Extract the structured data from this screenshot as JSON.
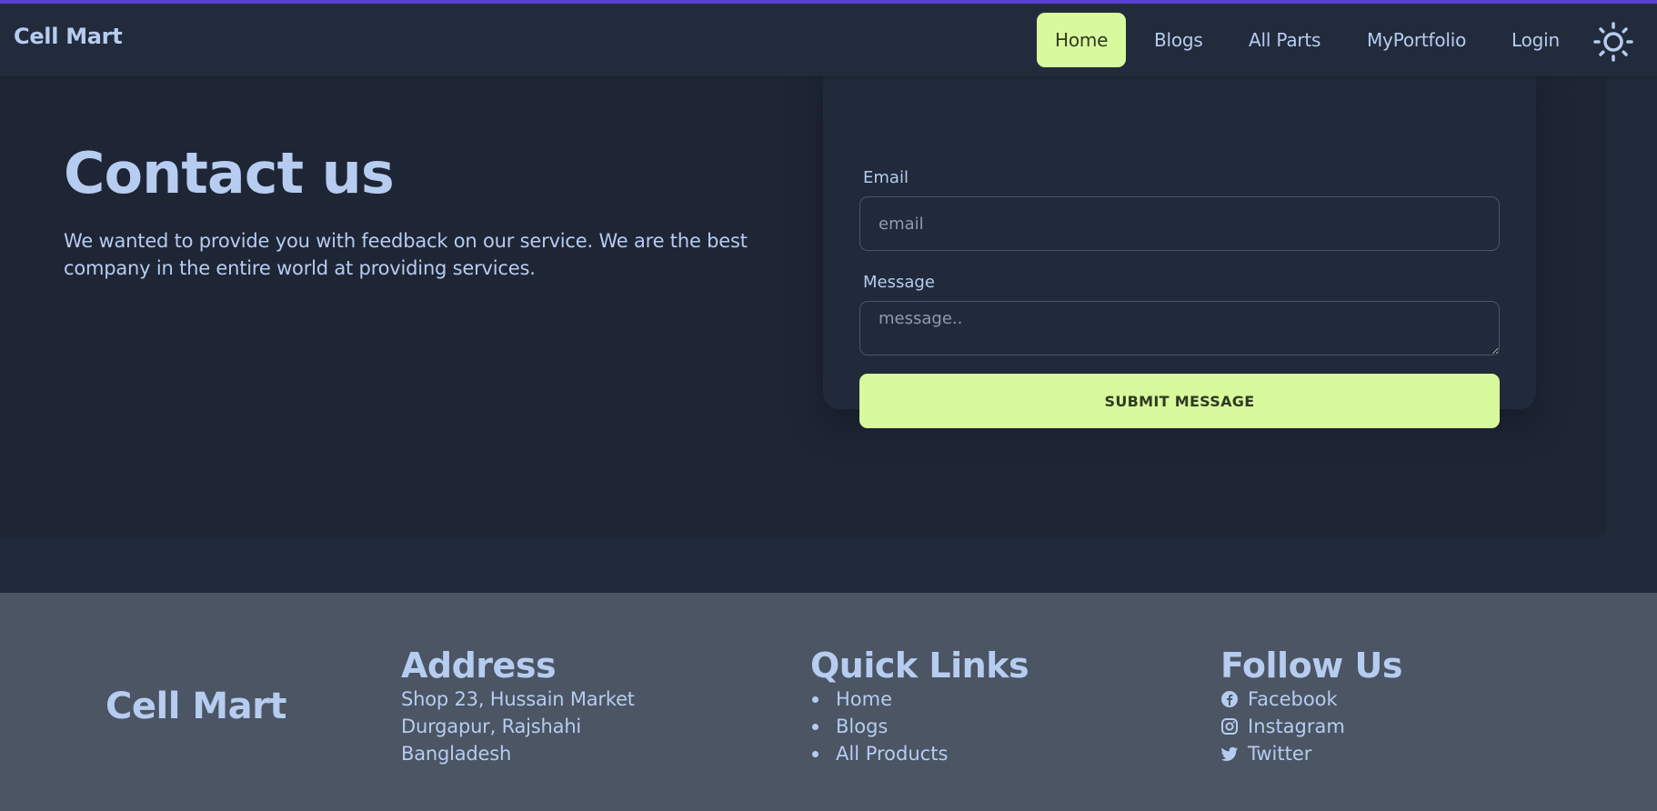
{
  "colors": {
    "accent": "#d9f99d",
    "navbar_bg": "#222b3b",
    "hero_bg": "#1e2535",
    "footer_bg": "#4b5563",
    "text": "#b6ccf0",
    "top_line": "#5b3fd6"
  },
  "navbar": {
    "brand": "Cell Mart",
    "items": [
      {
        "label": "Home",
        "active": true
      },
      {
        "label": "Blogs"
      },
      {
        "label": "All Parts"
      },
      {
        "label": "MyPortfolio"
      },
      {
        "label": "Login"
      }
    ],
    "theme_icon": "sun-icon"
  },
  "hero": {
    "title": "Contact us",
    "text": "We wanted to provide you with feedback on our service. We are the best company in the entire world at providing services."
  },
  "form": {
    "email_label": "Email",
    "email_placeholder": "email",
    "message_label": "Message",
    "message_placeholder": "message..",
    "submit_label": "SUBMIT MESSAGE"
  },
  "footer": {
    "brand": "Cell Mart",
    "address": {
      "heading": "Address",
      "lines": [
        "Shop 23, Hussain Market",
        "Durgapur, Rajshahi",
        "Bangladesh"
      ]
    },
    "quick_links": {
      "heading": "Quick Links",
      "items": [
        "Home",
        "Blogs",
        "All Products"
      ]
    },
    "follow": {
      "heading": "Follow Us",
      "items": [
        {
          "label": "Facebook",
          "icon": "facebook-icon"
        },
        {
          "label": "Instagram",
          "icon": "instagram-icon"
        },
        {
          "label": "Twitter",
          "icon": "twitter-icon"
        }
      ]
    }
  }
}
